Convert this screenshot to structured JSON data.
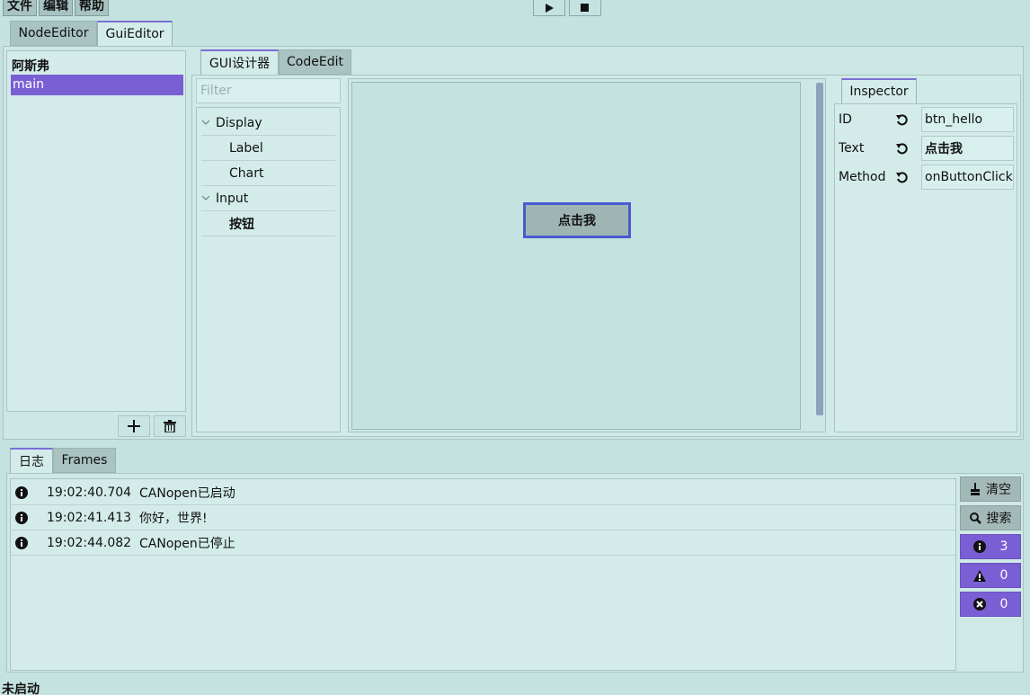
{
  "menu": {
    "file": "文件",
    "edit": "编辑",
    "help": "帮助"
  },
  "toolbar": {
    "play_icon": "play-icon",
    "stop_icon": "stop-icon"
  },
  "main_tabs": [
    {
      "label": "NodeEditor",
      "active": false
    },
    {
      "label": "GuiEditor",
      "active": true
    }
  ],
  "left_panel": {
    "group": "阿斯弗",
    "items": [
      "main"
    ],
    "selected": "main",
    "add_icon": "plus-icon",
    "delete_icon": "trash-icon"
  },
  "sub_tabs": [
    {
      "label": "GUI设计器",
      "active": true
    },
    {
      "label": "CodeEdit",
      "active": false
    }
  ],
  "palette": {
    "filter_placeholder": "Filter",
    "groups": [
      {
        "label": "Display",
        "items": [
          "Label",
          "Chart"
        ]
      },
      {
        "label": "Input",
        "items": [
          "按钮"
        ]
      }
    ]
  },
  "canvas": {
    "button_text": "点击我"
  },
  "inspector": {
    "tab": "Inspector",
    "rows": [
      {
        "label": "ID",
        "value": "btn_hello"
      },
      {
        "label": "Text",
        "value": "点击我"
      },
      {
        "label": "Method",
        "value": "onButtonClick"
      }
    ]
  },
  "bottom_tabs": [
    {
      "label": "日志",
      "active": true
    },
    {
      "label": "Frames",
      "active": false
    }
  ],
  "log": {
    "entries": [
      {
        "time": "19:02:40.704",
        "message": "CANopen已启动"
      },
      {
        "time": "19:02:41.413",
        "message": "你好，世界!"
      },
      {
        "time": "19:02:44.082",
        "message": "CANopen已停止"
      }
    ]
  },
  "log_actions": {
    "clear": "清空",
    "search": "搜索",
    "info_count": "3",
    "warning_count": "0",
    "error_count": "0"
  },
  "colors": {
    "background": "#c4e2e0",
    "accent": "#7a5fd4",
    "selection_border": "#4a5bd0"
  },
  "status": {
    "text": "未启动"
  }
}
